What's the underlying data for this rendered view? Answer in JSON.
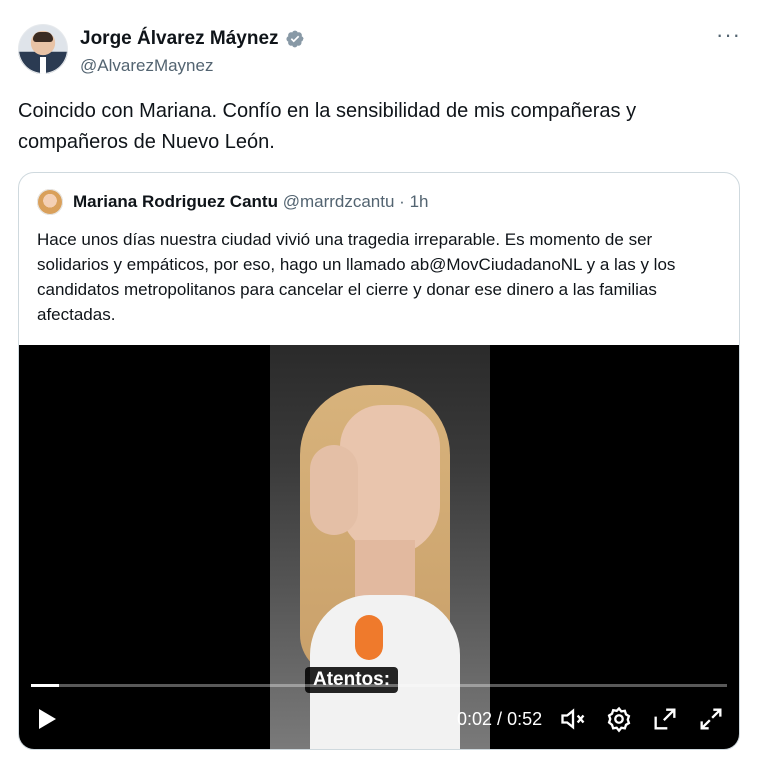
{
  "tweet": {
    "author_name": "Jorge Álvarez Máynez",
    "handle": "@AlvarezMaynez",
    "more_label": "···",
    "text": "Coincido con Mariana. Confío en la sensibilidad de mis compañeras y compañeros de Nuevo León."
  },
  "quote": {
    "author_name": "Mariana Rodriguez Cantu",
    "handle": "@marrdzcantu",
    "separator": " · ",
    "time": "1h",
    "text": "Hace unos días nuestra ciudad vivió una tragedia irreparable. Es momento de ser solidarios y empáticos, por eso, hago un llamado ab@MovCiudadanoNL y a las y los candidatos metropolitanos para cancelar el cierre y donar ese dinero a las familias afectadas."
  },
  "video": {
    "caption": "Atentos:",
    "current_time": "0:02",
    "time_separator": " / ",
    "duration": "0:52",
    "progress": 0.04
  },
  "icons": {
    "verified": "verified-badge-icon",
    "more": "more-icon",
    "play": "play-icon",
    "mute": "mute-icon",
    "settings": "settings-icon",
    "popout": "popout-icon",
    "fullscreen": "fullscreen-icon"
  },
  "colors": {
    "verified_blue": "#1d9bf0",
    "secondary_text": "#536471",
    "border": "#cfd9de"
  }
}
